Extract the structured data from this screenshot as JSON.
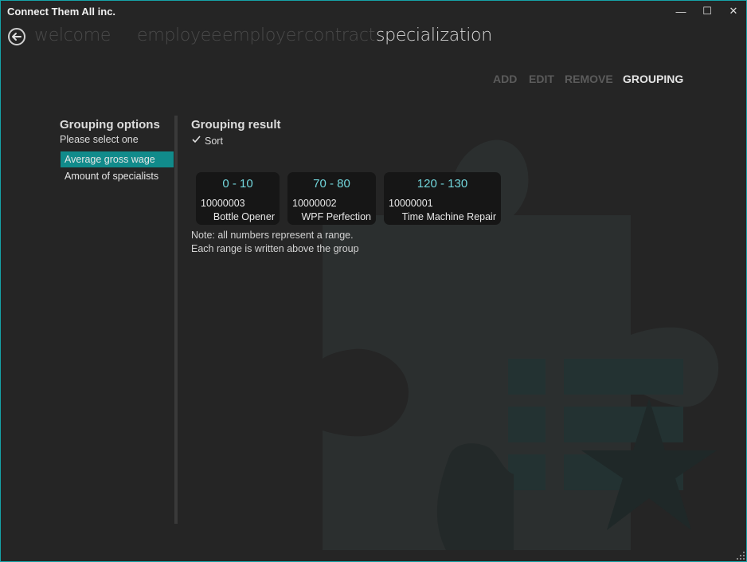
{
  "window": {
    "title": "Connect Them All inc.",
    "minimize": "—",
    "maximize": "☐",
    "close": "✕"
  },
  "nav": {
    "items": [
      {
        "label": "welcome"
      },
      {
        "label": "employee"
      },
      {
        "label": "employer"
      },
      {
        "label": "contract"
      },
      {
        "label": "specialization"
      }
    ],
    "active": "specialization"
  },
  "commands": [
    {
      "label": "ADD"
    },
    {
      "label": "EDIT"
    },
    {
      "label": "REMOVE"
    },
    {
      "label": "GROUPING"
    }
  ],
  "grouping_options": {
    "title": "Grouping options",
    "subtitle": "Please select one",
    "options": [
      {
        "label": "Average gross wage",
        "selected": true
      },
      {
        "label": "Amount of specialists",
        "selected": false
      }
    ]
  },
  "grouping_result": {
    "title": "Grouping result",
    "sort_label": "Sort",
    "sort_checked": true,
    "groups": [
      {
        "range": "0 - 10",
        "code": "10000003",
        "name": "Bottle Opener"
      },
      {
        "range": "70 - 80",
        "code": "10000002",
        "name": "WPF Perfection"
      },
      {
        "range": "120 - 130",
        "code": "10000001",
        "name": "Time Machine Repair"
      }
    ],
    "note_line1": "Note: all numbers represent a range.",
    "note_line2": "Each range is written above the group"
  },
  "colors": {
    "accent": "#118b8b",
    "range_text": "#72d6dc",
    "background": "#252525"
  }
}
